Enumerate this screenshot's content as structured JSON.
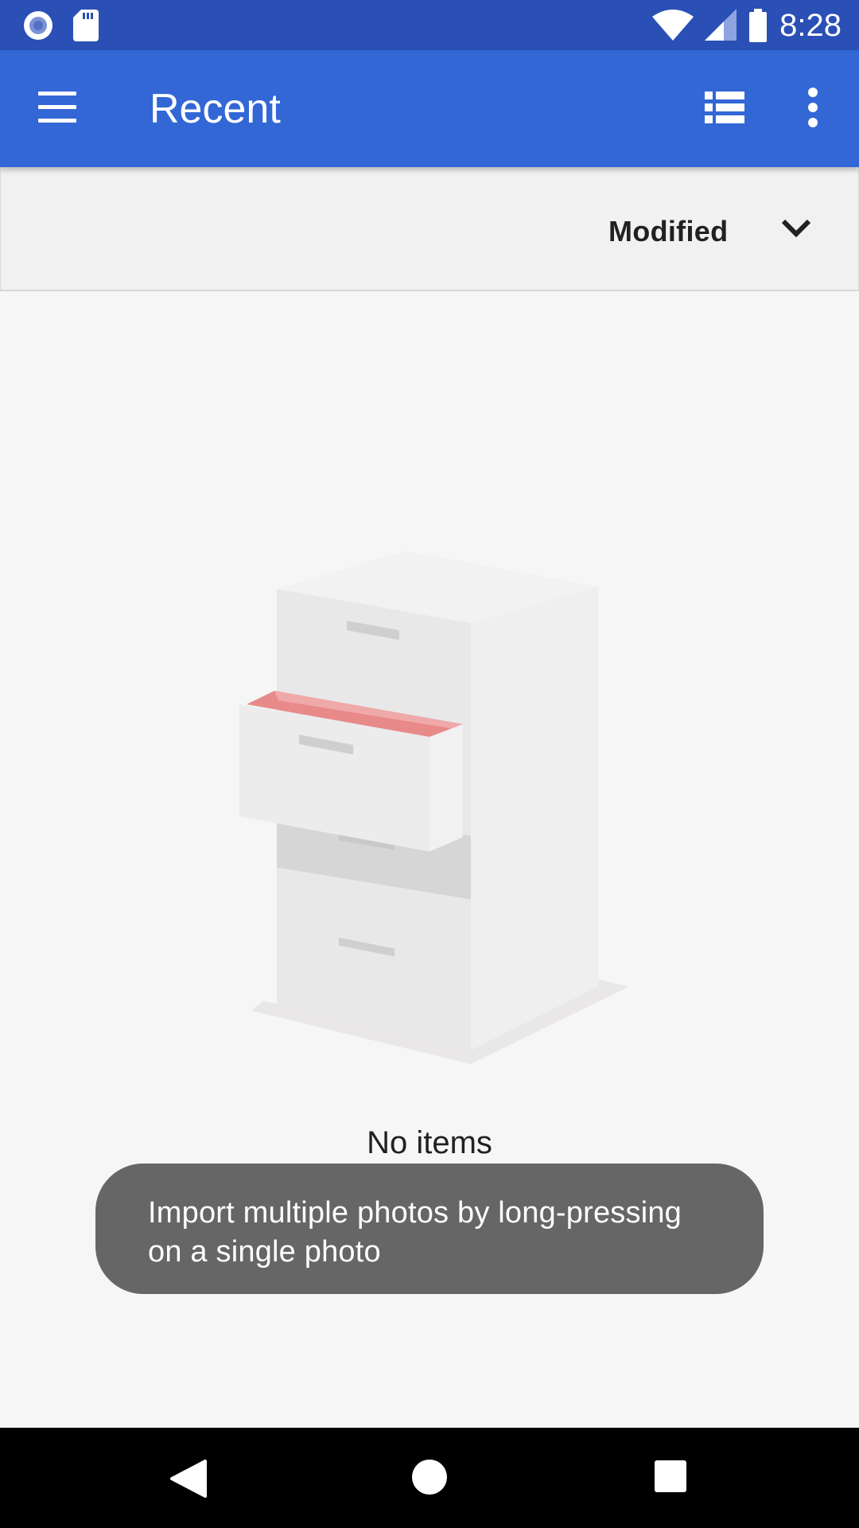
{
  "status_bar": {
    "time": "8:28",
    "left_icons": [
      "notification-dot-icon",
      "sd-card-icon"
    ],
    "right_icons": [
      "wifi-icon",
      "cell-signal-icon",
      "battery-icon"
    ]
  },
  "app_bar": {
    "title": "Recent",
    "nav_icon": "hamburger-menu-icon",
    "actions": [
      "list-view-icon",
      "more-vert-icon"
    ]
  },
  "sort_bar": {
    "sort_label": "Modified",
    "sort_icon": "chevron-down-icon"
  },
  "empty_state": {
    "illustration": "filing-cabinet-illustration",
    "message": "No items"
  },
  "toast": {
    "message": "Import multiple photos by long-pressing\non a single photo"
  },
  "nav_bar": {
    "buttons": [
      "back-icon",
      "home-icon",
      "recents-icon"
    ]
  },
  "colors": {
    "status_bar": "#2a50b5",
    "app_bar": "#3367d6",
    "background": "#f6f6f6",
    "toast": "#666666",
    "nav_bar": "#000000",
    "drawer_accent": "#e57373"
  }
}
